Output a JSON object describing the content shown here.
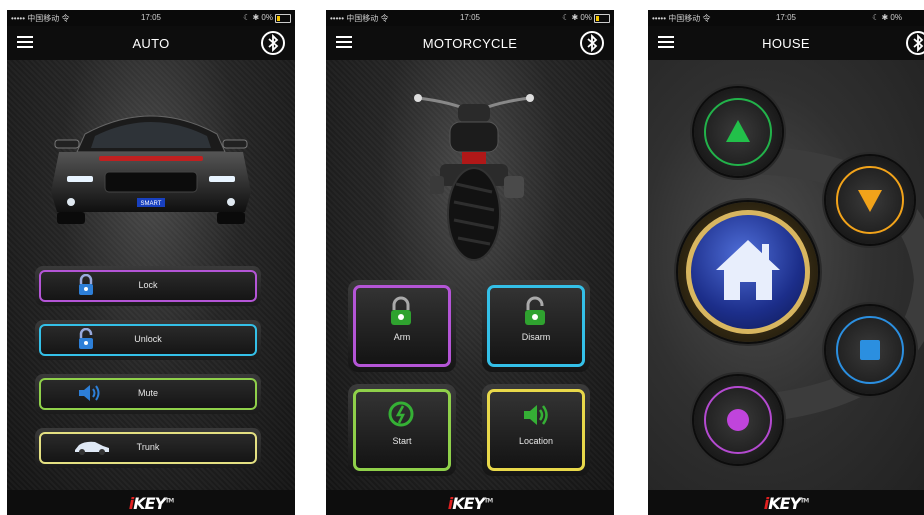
{
  "status_bar": {
    "carrier": "••••• 中国移动 令",
    "time": "17:05",
    "right": "☾ ✱ 0%"
  },
  "brand": {
    "logo_text": "KEY",
    "logo_tm": "TM"
  },
  "screens": {
    "auto": {
      "title": "AUTO",
      "plate": "SMART",
      "buttons": [
        {
          "label": "Lock",
          "icon": "padlock-icon",
          "color": "#b455d6"
        },
        {
          "label": "Unlock",
          "icon": "padlock-open-icon",
          "color": "#34c0e8"
        },
        {
          "label": "Mute",
          "icon": "speaker-icon",
          "color": "#8fd04a"
        },
        {
          "label": "Trunk",
          "icon": "car-icon",
          "color": "#e4e082"
        }
      ]
    },
    "motorcycle": {
      "title": "MOTORCYCLE",
      "tiles": [
        {
          "label": "Arm",
          "icon": "green-padlock-icon",
          "color": "#b455d6"
        },
        {
          "label": "Disarm",
          "icon": "green-padlock-open-icon",
          "color": "#34c0e8"
        },
        {
          "label": "Start",
          "icon": "start-icon",
          "color": "#8fd04a"
        },
        {
          "label": "Location",
          "icon": "speaker-icon",
          "color": "#e8d84a"
        }
      ]
    },
    "house": {
      "title": "HOUSE",
      "controls": [
        {
          "icon": "up-arrow-icon",
          "color": "#22b24a"
        },
        {
          "icon": "down-arrow-icon",
          "color": "#f2a31a"
        },
        {
          "icon": "home-icon",
          "color": "#c9a24a"
        },
        {
          "icon": "stop-icon",
          "color": "#2b8fe0"
        },
        {
          "icon": "record-icon",
          "color": "#b44ad0"
        }
      ]
    }
  }
}
